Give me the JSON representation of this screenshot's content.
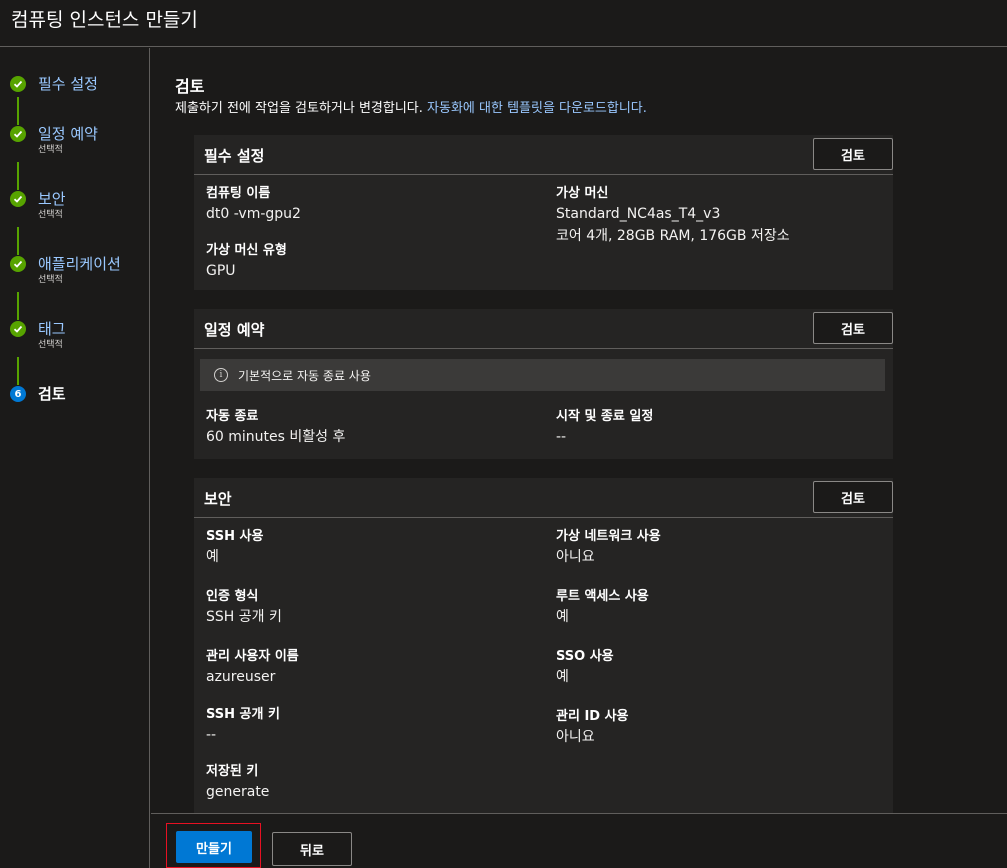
{
  "window": {
    "title": "컴퓨팅 인스턴스 만들기"
  },
  "sidebar": {
    "steps": [
      {
        "label": "필수 설정",
        "sub": "",
        "state": "done"
      },
      {
        "label": "일정 예약",
        "sub": "선택적",
        "state": "done"
      },
      {
        "label": "보안",
        "sub": "선택적",
        "state": "done"
      },
      {
        "label": "애플리케이션",
        "sub": "선택적",
        "state": "done"
      },
      {
        "label": "태그",
        "sub": "선택적",
        "state": "done"
      },
      {
        "label": "검토",
        "sub": "",
        "state": "current",
        "number": "6"
      }
    ]
  },
  "main": {
    "heading": "검토",
    "subtitle_text": "제출하기 전에 작업을 검토하거나 변경합니다.",
    "subtitle_link": "자동화에 대한 템플릿을 다운로드합니다.",
    "review_label": "검토",
    "sections": {
      "required": {
        "title": "필수 설정",
        "compute_name_label": "컴퓨팅 이름",
        "compute_name_value": "dt0  -vm-gpu2",
        "vm_type_label": "가상 머신 유형",
        "vm_type_value": "GPU",
        "vm_label": "가상 머신",
        "vm_value": "Standard_NC4as_T4_v3",
        "vm_detail": "코어 4개, 28GB RAM, 176GB 저장소"
      },
      "schedule": {
        "title": "일정 예약",
        "info": "기본적으로 자동 종료 사용",
        "auto_shutdown_label": "자동 종료",
        "auto_shutdown_value": "60 minutes 비활성 후",
        "start_stop_label": "시작 및 종료 일정",
        "start_stop_value": "--"
      },
      "security": {
        "title": "보안",
        "ssh_label": "SSH 사용",
        "ssh_value": "예",
        "auth_label": "인증 형식",
        "auth_value": "SSH 공개 키",
        "admin_label": "관리 사용자 이름",
        "admin_value": "azureuser",
        "ssh_key_label": "SSH 공개 키",
        "ssh_key_value": "--",
        "stored_key_label": "저장된 키",
        "stored_key_value": "generate",
        "vnet_label": "가상 네트워크 사용",
        "vnet_value": "아니요",
        "root_label": "루트 액세스 사용",
        "root_value": "예",
        "sso_label": "SSO 사용",
        "sso_value": "예",
        "mid_label": "관리 ID 사용",
        "mid_value": "아니요"
      }
    }
  },
  "footer": {
    "create_label": "만들기",
    "back_label": "뒤로"
  },
  "colors": {
    "accent": "#0078d4",
    "done": "#57a300",
    "link": "#9ac8ff",
    "highlight": "#e81123"
  }
}
